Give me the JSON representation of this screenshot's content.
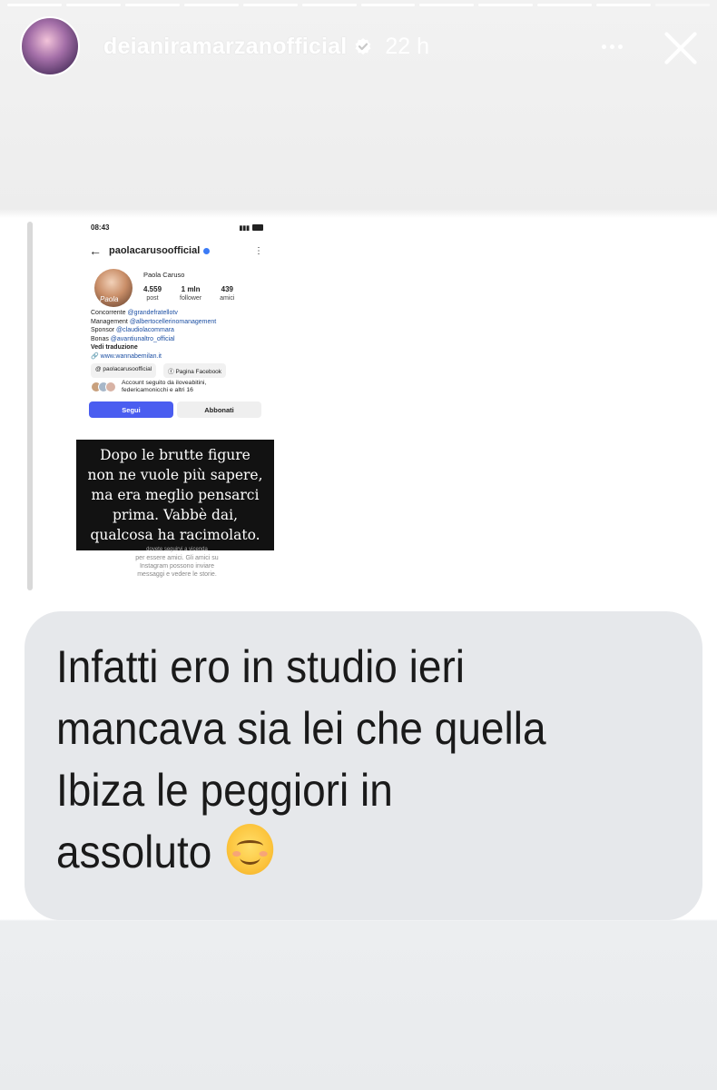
{
  "story": {
    "segments_total": 12,
    "segments_done": 11,
    "username": "deianiramarzanofficial",
    "time_ago": "22 h",
    "icons": {
      "avatar": "avatar",
      "verified": "verified-badge-icon",
      "more": "more-horizontal-icon",
      "close": "close-icon"
    }
  },
  "screenshot": {
    "status_time": "08:43",
    "status_icons": "⏰ 📶",
    "battery": "85",
    "handle": "paolacarusoofficial",
    "back_icon": "←",
    "kebab_icon": "⋮",
    "avatar_label": "Paola",
    "display_name": "Paola Caruso",
    "stats": [
      {
        "value": "4.559",
        "label": "post"
      },
      {
        "value": "1 mln",
        "label": "follower"
      },
      {
        "value": "439",
        "label": "amici"
      }
    ],
    "bio": [
      {
        "prefix": "Concorrente ",
        "link": "@grandefratellotv"
      },
      {
        "prefix": "Management ",
        "link": "@albertocellerinomanagement"
      },
      {
        "prefix": "Sponsor ",
        "link": "@claudiolacommara"
      },
      {
        "prefix": "Bonas ",
        "link": "@avantiunaltro_official"
      }
    ],
    "translate": "Vedi traduzione",
    "website": "www.wannabemilan.it",
    "chips": [
      "paolacarusoofficial",
      "Pagina Facebook"
    ],
    "followed_by": [
      "Account seguito da iloveabitini,",
      "federicamonicchi e altri 16"
    ],
    "follow_button": "Segui",
    "subscribe_button": "Abbonati",
    "overlay_lines": [
      "Dopo le brutte figure",
      "non ne vuole più sapere,",
      "ma era meglio pensarci",
      "prima. Vabbè dai,",
      "qualcosa ha racimolato."
    ],
    "below_lines": [
      "dovete seguirvi a vicenda",
      "per essere amici. Gli amici su",
      "Instagram possono inviare",
      "messaggi e vedere le storie."
    ]
  },
  "message": {
    "lines": [
      "Infatti ero in studio ieri",
      "mancava sia lei che quella",
      "Ibiza le peggiori in",
      "assoluto"
    ],
    "emoji": "smiling-face-with-blush"
  }
}
